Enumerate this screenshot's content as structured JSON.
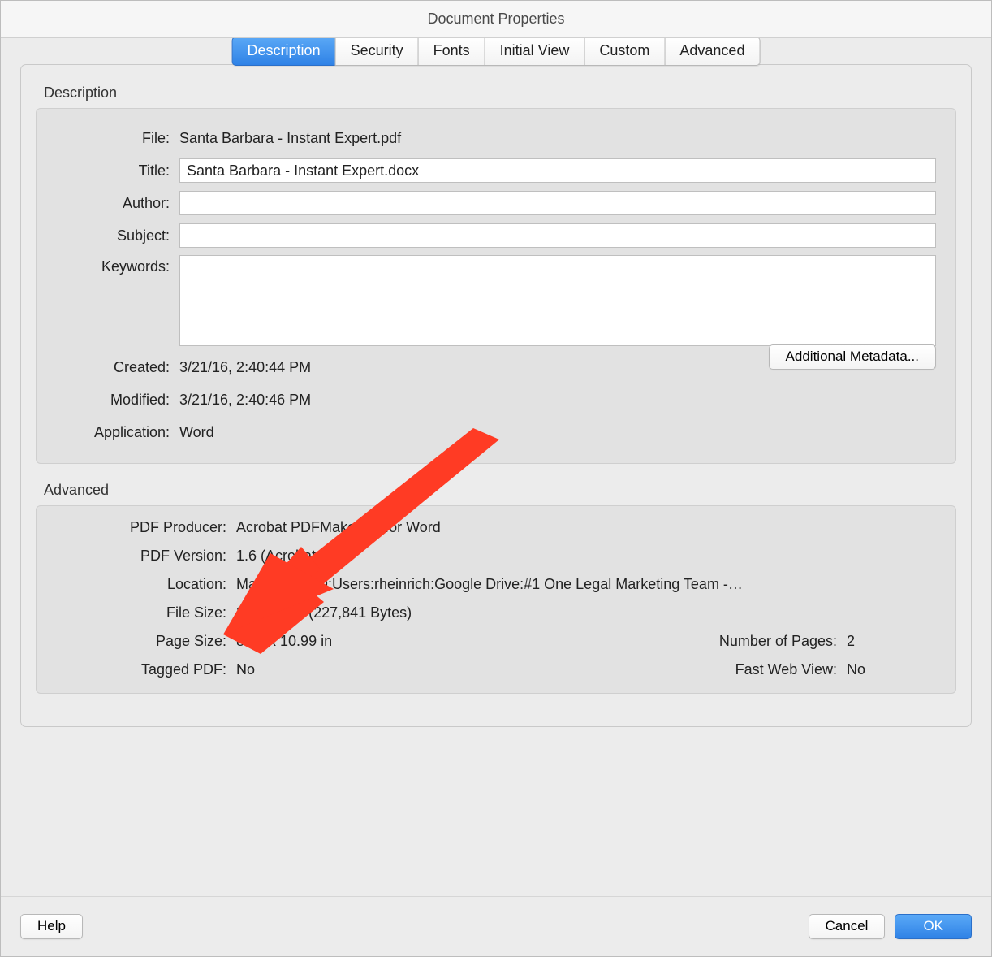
{
  "window": {
    "title": "Document Properties"
  },
  "tabs": {
    "description": "Description",
    "security": "Security",
    "fonts": "Fonts",
    "initial_view": "Initial View",
    "custom": "Custom",
    "advanced": "Advanced"
  },
  "description_section": {
    "title": "Description",
    "fields": {
      "file_label": "File:",
      "file_value": "Santa Barbara - Instant Expert.pdf",
      "title_label": "Title:",
      "title_value": "Santa Barbara - Instant Expert.docx",
      "author_label": "Author:",
      "author_value": "",
      "subject_label": "Subject:",
      "subject_value": "",
      "keywords_label": "Keywords:",
      "keywords_value": "",
      "created_label": "Created:",
      "created_value": "3/21/16, 2:40:44 PM",
      "modified_label": "Modified:",
      "modified_value": "3/21/16, 2:40:46 PM",
      "application_label": "Application:",
      "application_value": "Word"
    },
    "additional_metadata_button": "Additional Metadata..."
  },
  "advanced_section": {
    "title": "Advanced",
    "fields": {
      "pdf_producer_label": "PDF Producer:",
      "pdf_producer_value": "Acrobat PDFMaker 15 for Word",
      "pdf_version_label": "PDF Version:",
      "pdf_version_value": "1.6 (Acrobat 7.x)",
      "location_label": "Location:",
      "location_value": "Macintosh HD:Users:rheinrich:Google Drive:#1 One Legal Marketing Team -…",
      "file_size_label": "File Size:",
      "file_size_value": "222.50 KB (227,841 Bytes)",
      "page_size_label": "Page Size:",
      "page_size_value": "8.50 x 10.99 in",
      "num_pages_label": "Number of Pages:",
      "num_pages_value": "2",
      "tagged_pdf_label": "Tagged PDF:",
      "tagged_pdf_value": "No",
      "fast_web_view_label": "Fast Web View:",
      "fast_web_view_value": "No"
    }
  },
  "footer": {
    "help": "Help",
    "cancel": "Cancel",
    "ok": "OK"
  },
  "annotation": {
    "arrow_color": "#ff3b24"
  }
}
